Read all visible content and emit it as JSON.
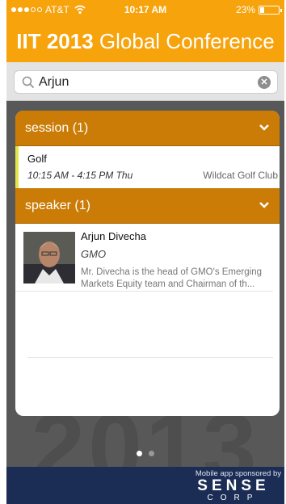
{
  "status_bar": {
    "carrier": "AT&T",
    "time": "10:17 AM",
    "battery": "23%"
  },
  "app": {
    "title_bold": "IIT 2013",
    "title_rest": "Global Conference"
  },
  "search": {
    "value": "Arjun",
    "placeholder": "Search"
  },
  "sections": {
    "session": {
      "header": "session (1)",
      "items": [
        {
          "title": "Golf",
          "time": "10:15 AM - 4:15 PM Thu",
          "location": "Wildcat Golf Club"
        }
      ]
    },
    "speaker": {
      "header": "speaker (1)",
      "items": [
        {
          "name": "Arjun Divecha",
          "organization": "GMO",
          "bio": "Mr. Divecha is the head of GMO's Emerging Markets Equity team and Chairman of th..."
        }
      ]
    }
  },
  "background_text": "2013",
  "pager": {
    "pages": 2,
    "active": 1
  },
  "footer": {
    "sponsor_text": "Mobile app sponsored by",
    "sponsor_name": "SENSE",
    "sponsor_sub": "CORP"
  },
  "colors": {
    "header": "#f7a30c",
    "section_header": "#ca7c06",
    "session_accent": "#e2e548",
    "footer": "#1b2d55"
  }
}
